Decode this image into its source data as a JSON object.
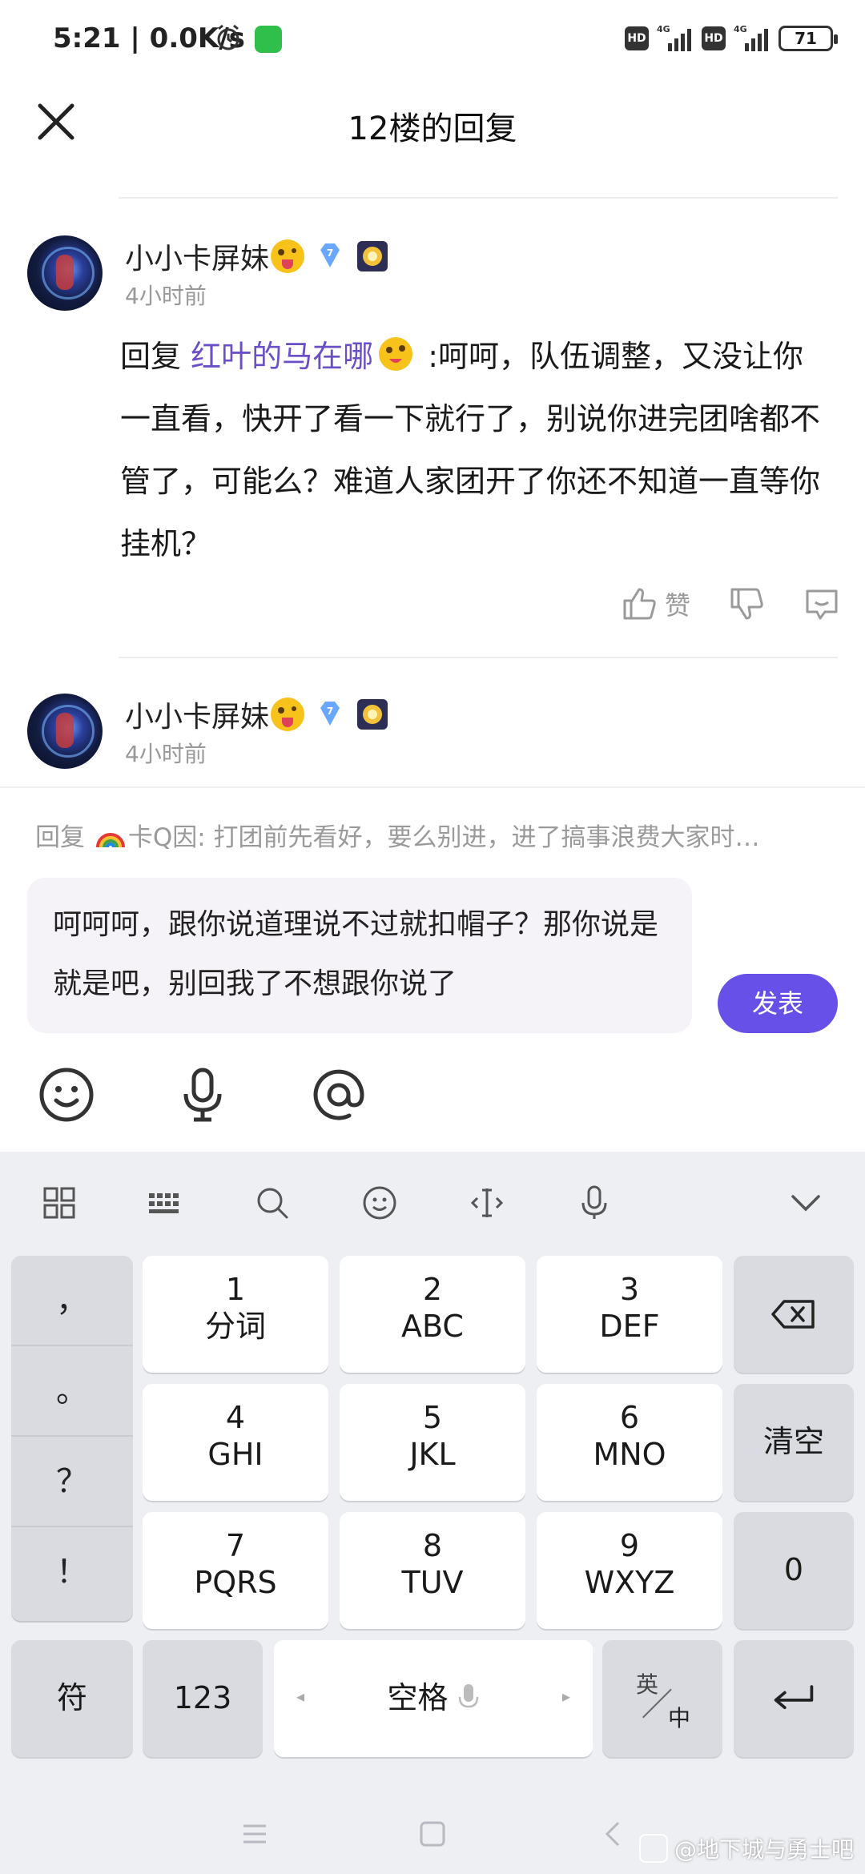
{
  "status_bar": {
    "time": "5:21",
    "net_speed": "0.0K/s",
    "hd1": "HD",
    "hd2": "HD",
    "net1": "4G",
    "net2": "4G",
    "battery": "71"
  },
  "header": {
    "title": "12楼的回复"
  },
  "replies": [
    {
      "username": "小小卡屏妹",
      "level_badge": "7",
      "time": "4小时前",
      "prefix": "回复 ",
      "mention": "红叶的马在哪",
      "text": " :呵呵，队伍调整，又没让你一直看，快开了看一下就行了，别说你进完团啥都不管了，可能么？难道人家团开了你还不知道一直等你挂机？",
      "like_label": "赞"
    },
    {
      "username": "小小卡屏妹",
      "level_badge": "7",
      "time": "4小时前"
    }
  ],
  "composer": {
    "reply_prefix": "回复 ",
    "reply_target": "卡Q因: 打团前先看好，要么别进，进了搞事浪费大家时…",
    "input_text": "呵呵呵，跟你说道理说不过就扣帽子？那你说是就是吧，别回我了不想跟你说了",
    "send_label": "发表"
  },
  "keyboard": {
    "punct": [
      "，",
      "。",
      "？",
      "！"
    ],
    "keys": [
      {
        "num": "1",
        "let": "分词"
      },
      {
        "num": "2",
        "let": "ABC"
      },
      {
        "num": "3",
        "let": "DEF"
      },
      {
        "num": "4",
        "let": "GHI"
      },
      {
        "num": "5",
        "let": "JKL"
      },
      {
        "num": "6",
        "let": "MNO"
      },
      {
        "num": "7",
        "let": "PQRS"
      },
      {
        "num": "8",
        "let": "TUV"
      },
      {
        "num": "9",
        "let": "WXYZ"
      }
    ],
    "clear_label": "清空",
    "zero_label": "0",
    "symbol_label": "符",
    "numeric_label": "123",
    "space_label": "空格",
    "lang_top": "英",
    "lang_bottom": "中"
  },
  "watermark": "@地下城与勇士吧",
  "colors": {
    "accent": "#6650e8",
    "mention": "#6a4fc7"
  }
}
